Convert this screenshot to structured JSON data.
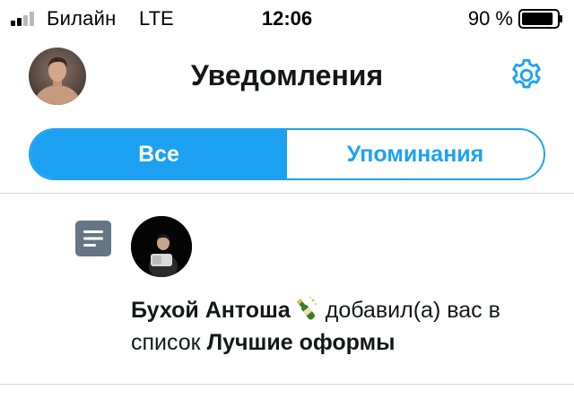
{
  "status_bar": {
    "carrier": "Билайн",
    "network": "LTE",
    "time": "12:06",
    "battery_percent": "90 %",
    "battery_level": 0.9,
    "signal_bars": 2
  },
  "header": {
    "title": "Уведомления",
    "icons": {
      "settings": "gear-icon"
    }
  },
  "tabs": {
    "items": [
      {
        "label": "Все",
        "active": true
      },
      {
        "label": "Упоминания",
        "active": false
      }
    ]
  },
  "notifications": [
    {
      "type_icon": "list-icon",
      "user_name": "Бухой Антоша",
      "emoji": "champagne-bottle",
      "action_text": "добавил(а) вас в список",
      "list_name": "Лучшие оформы"
    }
  ],
  "colors": {
    "accent": "#1da1f2",
    "text": "#14171a",
    "icon_gray": "#657786",
    "divider": "#cfd6dc"
  }
}
